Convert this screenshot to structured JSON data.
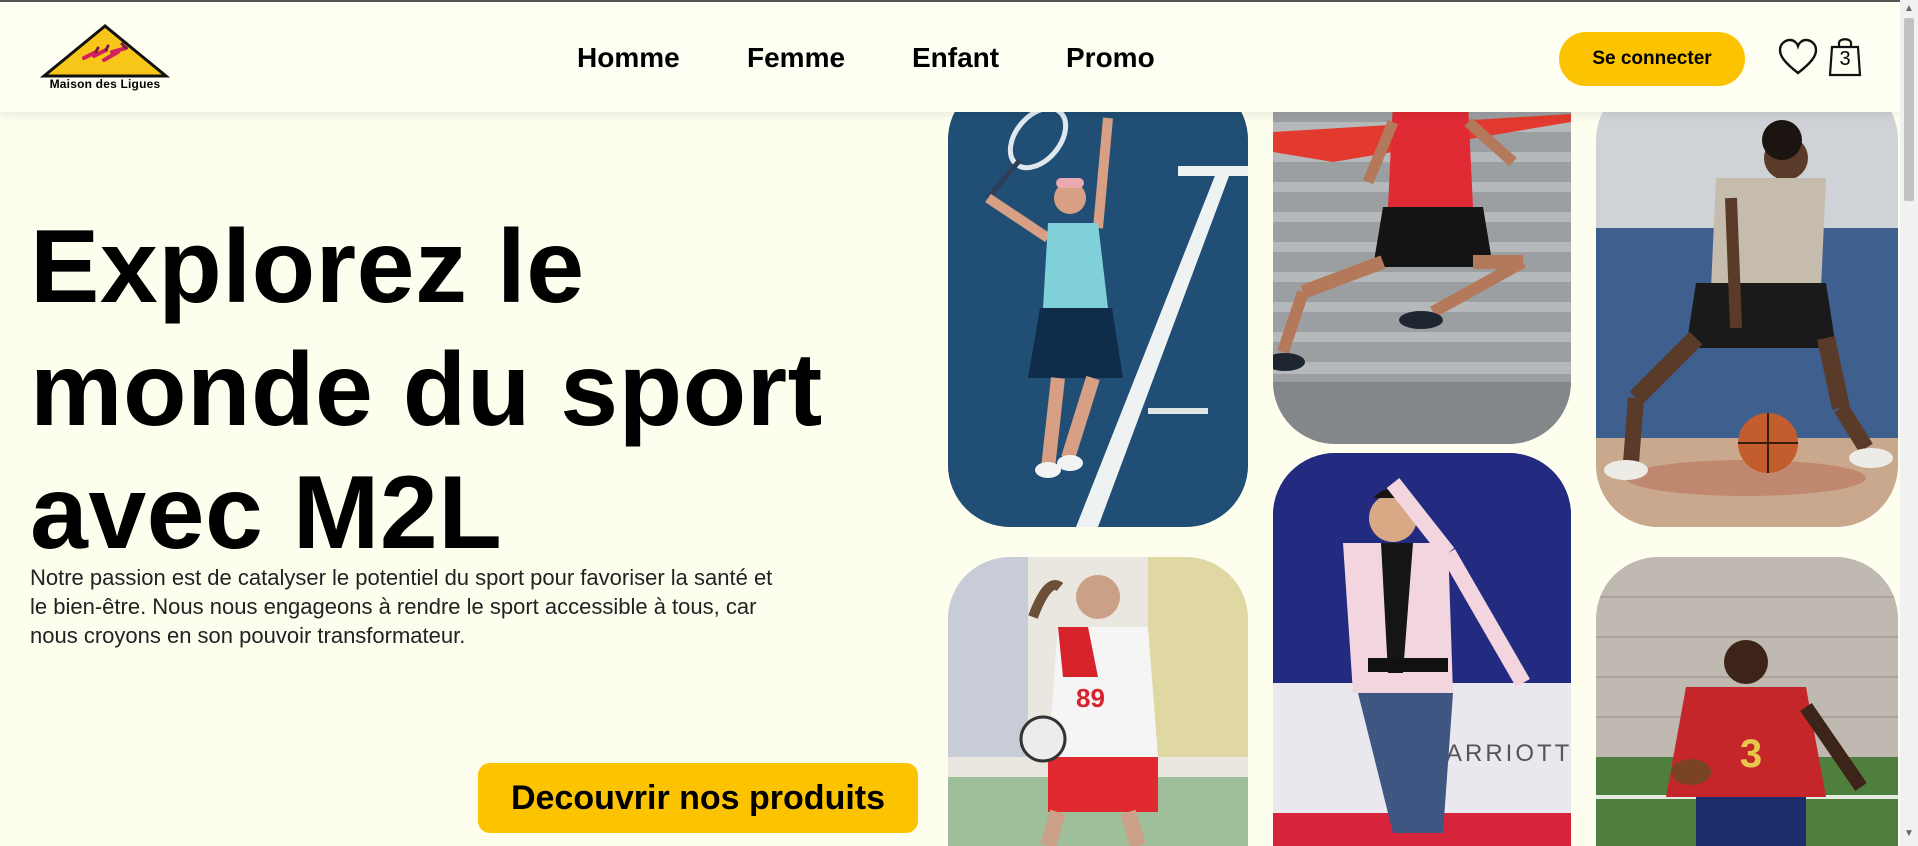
{
  "brand": {
    "name": "Maison des Ligues"
  },
  "nav": {
    "items": [
      "Homme",
      "Femme",
      "Enfant",
      "Promo"
    ]
  },
  "header": {
    "login_label": "Se connecter",
    "cart_count": "3",
    "icons": {
      "wishlist": "heart-icon",
      "cart": "shopping-bag-icon"
    }
  },
  "hero": {
    "title_lines": [
      "Explorez le",
      "monde du sport",
      "avec M2L"
    ],
    "description": "Notre passion est de catalyser le potentiel du sport pour favoriser la santé et le bien-être. Nous nous engageons à rendre le sport accessible à tous, car nous croyons en son pouvoir transformateur.",
    "cta_label": "Decouvrir nos produits"
  },
  "gallery": {
    "photos": [
      {
        "name": "tennis-player",
        "caption": ""
      },
      {
        "name": "runner",
        "caption": ""
      },
      {
        "name": "basketball-player",
        "caption": ""
      },
      {
        "name": "handball-player",
        "caption": "",
        "jersey": "89"
      },
      {
        "name": "taekwondo-athlete",
        "caption": "",
        "banner": "MARRIOTT MANILA"
      },
      {
        "name": "football-player",
        "caption": "",
        "jersey": "3"
      }
    ]
  },
  "colors": {
    "accent": "#fcc400",
    "background": "#fefeef"
  }
}
